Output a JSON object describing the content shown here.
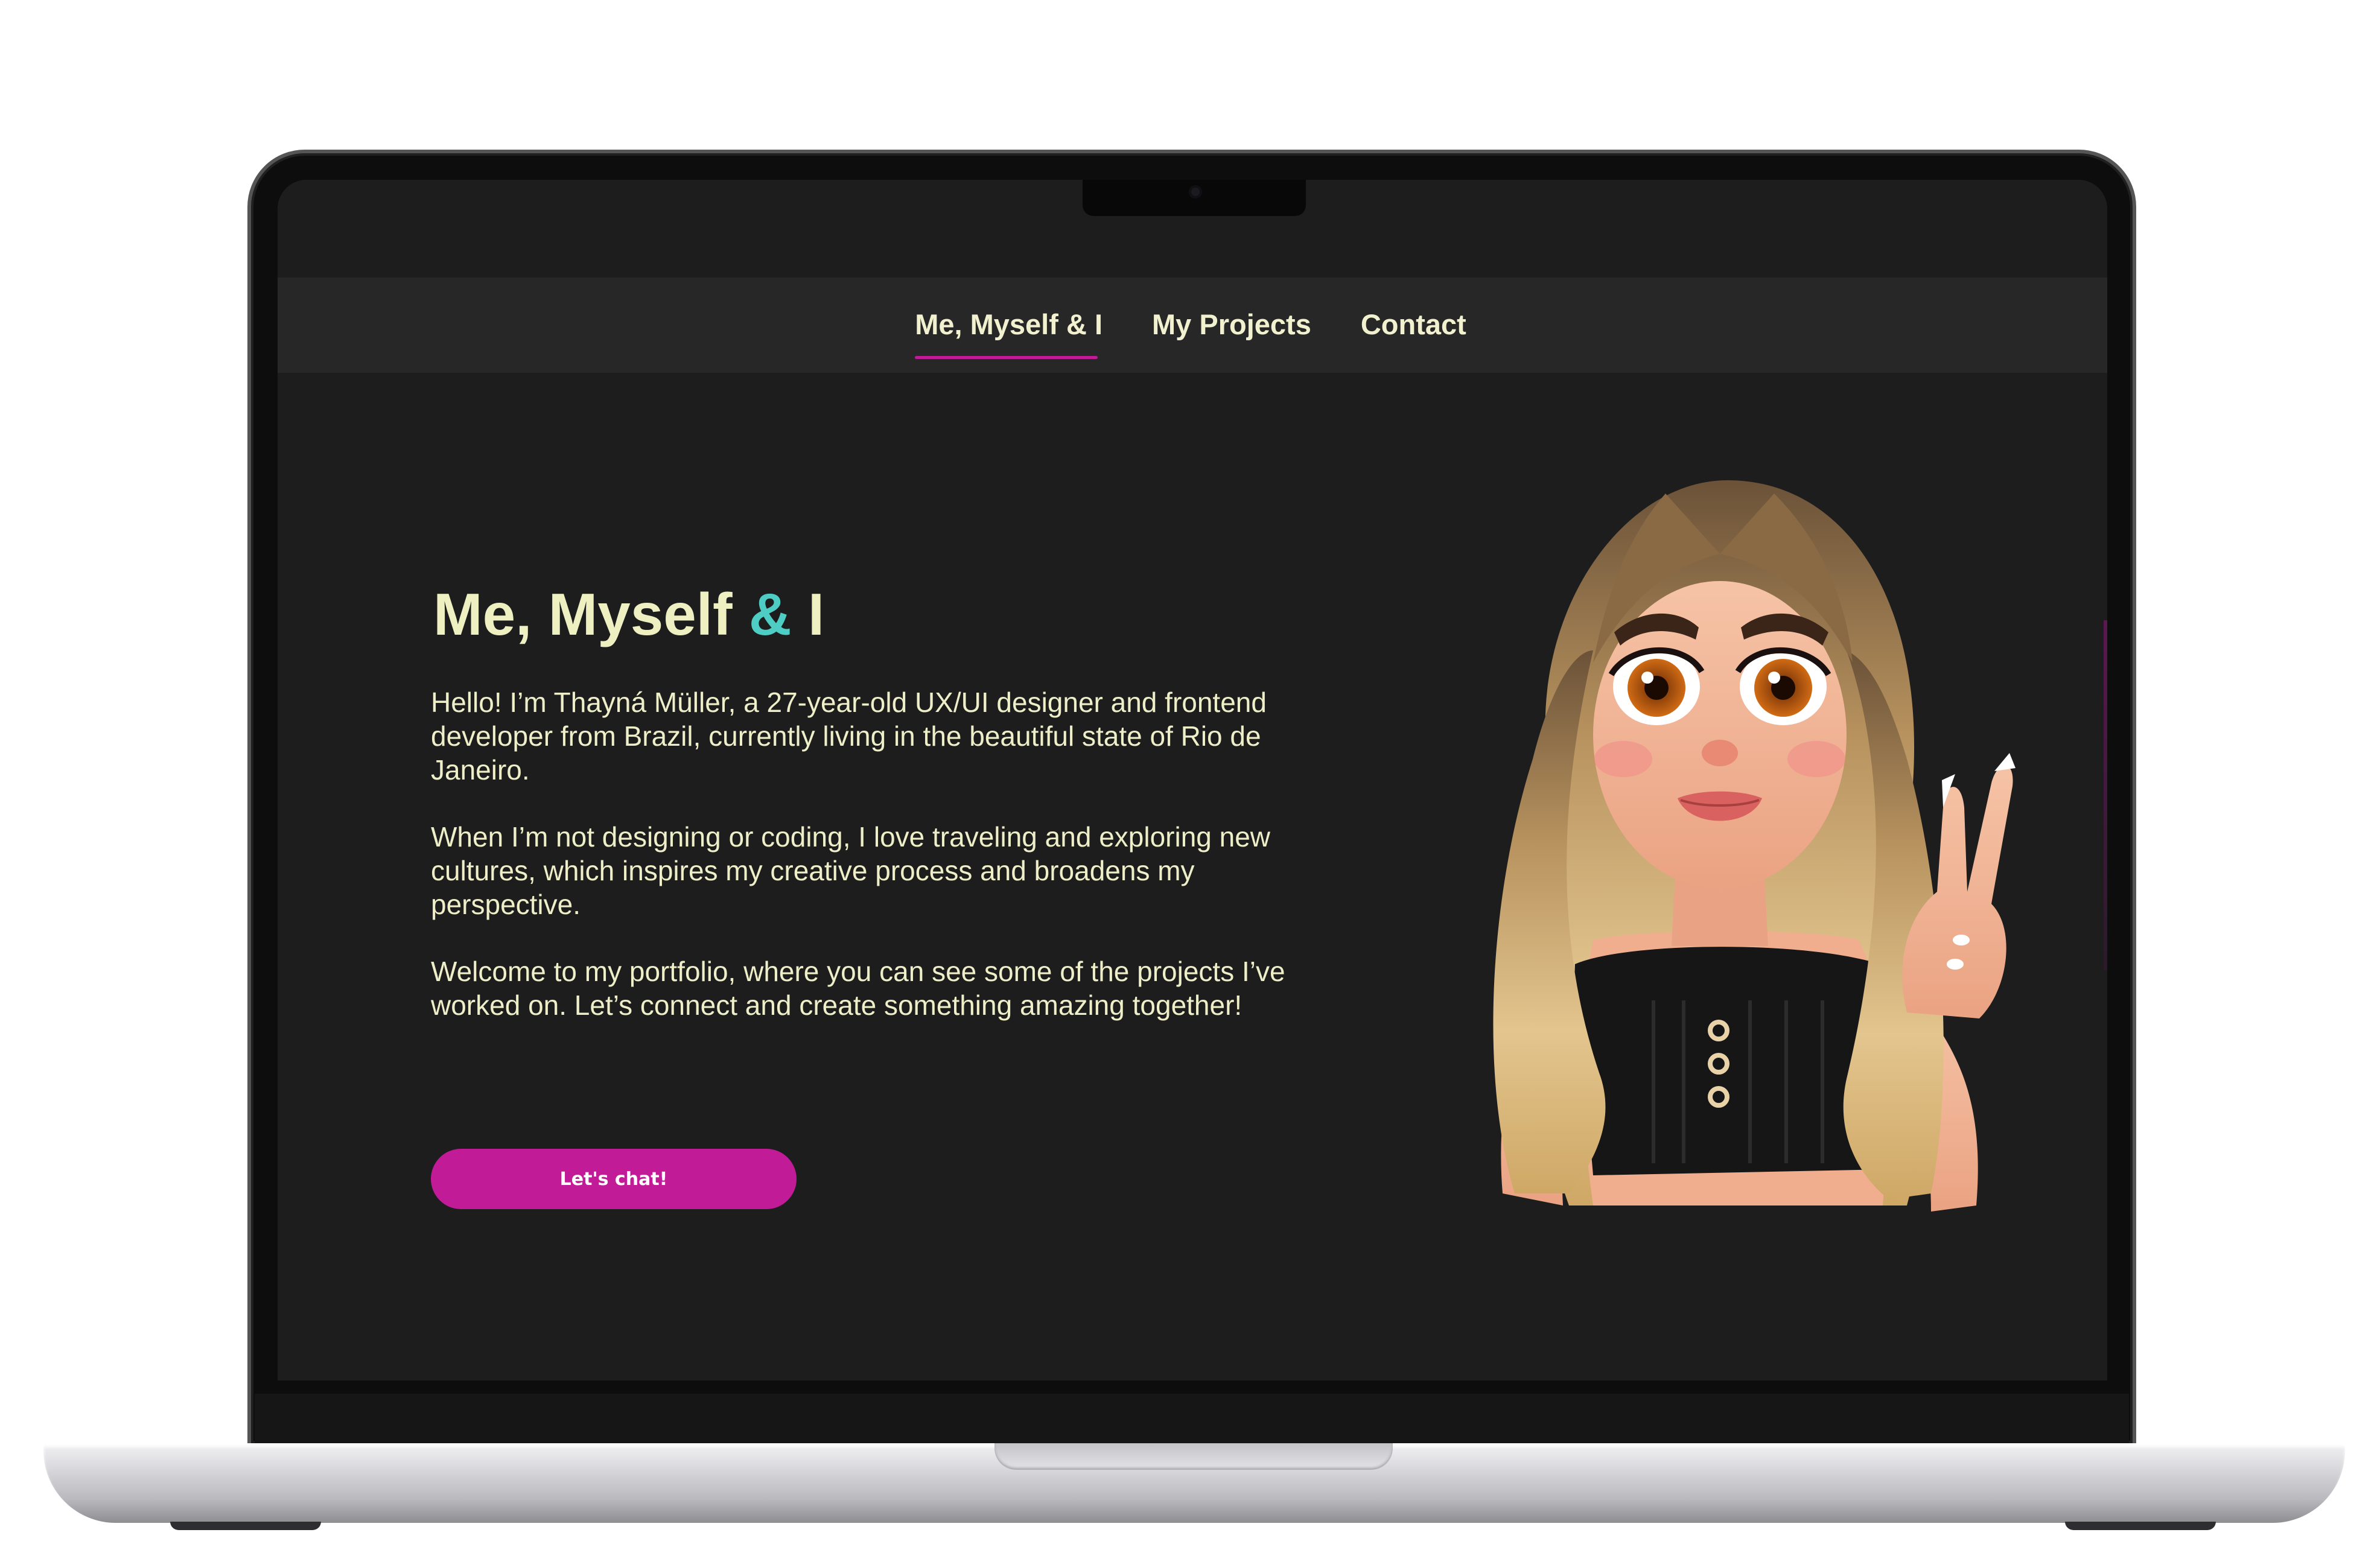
{
  "nav": {
    "items": [
      {
        "label": "Me, Myself & I",
        "active": true
      },
      {
        "label": "My Projects",
        "active": false
      },
      {
        "label": "Contact",
        "active": false
      }
    ]
  },
  "hero": {
    "title_main": "Me, Myself ",
    "title_accent": "&",
    "title_end": " I",
    "paragraphs": [
      "Hello! I’m Thayná Müller, a 27-year-old UX/UI designer and frontend developer from Brazil, currently living in the beautiful state of Rio de Janeiro.",
      "When I’m not designing or coding, I love traveling and exploring new cultures, which inspires my creative process and broadens my perspective.",
      "Welcome to my portfolio, where you can see some of the projects I’ve worked on. Let’s connect and create something amazing together!"
    ],
    "cta_label": "Let's chat!"
  },
  "colors": {
    "background": "#1d1d1d",
    "navbar": "#272727",
    "text": "#eeeec8",
    "accent_teal": "#4ecdc4",
    "accent_magenta": "#c21b97"
  },
  "icons": {
    "avatar": "3d-cartoon-avatar-peace-sign",
    "camera": "webcam-dot"
  }
}
